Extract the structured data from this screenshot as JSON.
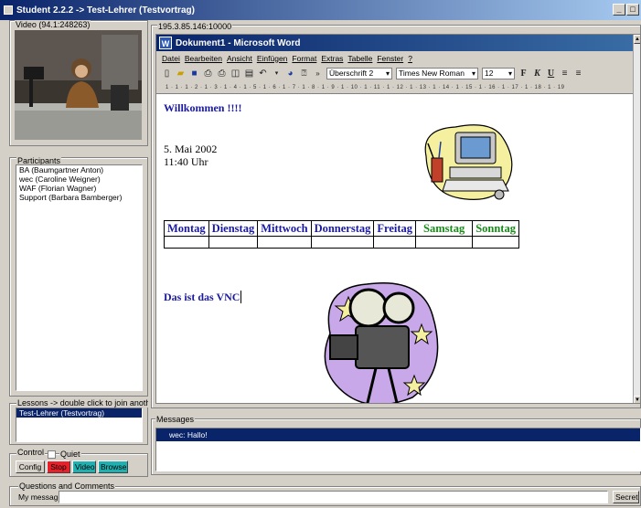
{
  "window": {
    "title": "Student 2.2.2 -> Test-Lehrer (Testvortrag)",
    "minimize": "_",
    "maximize": "□"
  },
  "video": {
    "label": "Video (94.1:248263)"
  },
  "participants": {
    "label": "Participants",
    "items": [
      "BA (Baumgartner Anton)",
      "wec (Caroline Weigner)",
      "WAF (Florian Wagner)",
      "Support (Barbara Bamberger)"
    ]
  },
  "lessons": {
    "label": "Lessons -> double click to join another one",
    "items": [
      "Test-Lehrer (Testvortrag)"
    ]
  },
  "control": {
    "label": "Control",
    "quiet_label": "Quiet",
    "buttons": {
      "config": "Config",
      "stop": "Stop",
      "video": "Video",
      "browse": "Browse"
    }
  },
  "vnc": {
    "address": "195.3.85.146:10000"
  },
  "word": {
    "title": "Dokument1 - Microsoft Word",
    "menu": [
      "Datei",
      "Bearbeiten",
      "Ansicht",
      "Einfügen",
      "Format",
      "Extras",
      "Tabelle",
      "Fenster",
      "?"
    ],
    "style_value": "Überschrift 2",
    "font_value": "Times New Roman",
    "size_value": "12",
    "bold": "F",
    "italic": "K",
    "underline": "U",
    "ruler": "1 · 1 · 1 · 2 · 1 · 3 · 1 · 4 · 1 · 5 · 1 · 6 · 1 · 7 · 1 · 8 · 1 · 9 · 1 · 10 · 1 · 11 · 1 · 12 · 1 · 13 · 1 · 14 · 1 · 15 · 1 · 16 · 1 · 17 · 1 · 18 · 1 · 19",
    "doc": {
      "welcome": "Willkommen !!!!",
      "date": "5. Mai 2002",
      "time": "11:40 Uhr",
      "days": [
        "Montag",
        "Dienstag",
        "Mittwoch",
        "Donnerstag",
        "Freitag",
        "Samstag",
        "Sonntag"
      ],
      "vnc_text": "Das ist das VNC"
    },
    "colors": {
      "blue": "#1a1aa0",
      "green": "#1a8a1a"
    }
  },
  "messages": {
    "label": "Messages",
    "items": [
      "wec: Hallo!"
    ]
  },
  "questions": {
    "label": "Questions and Comments",
    "my_message_label": "My message:",
    "message_value": "",
    "send": "Secret"
  }
}
